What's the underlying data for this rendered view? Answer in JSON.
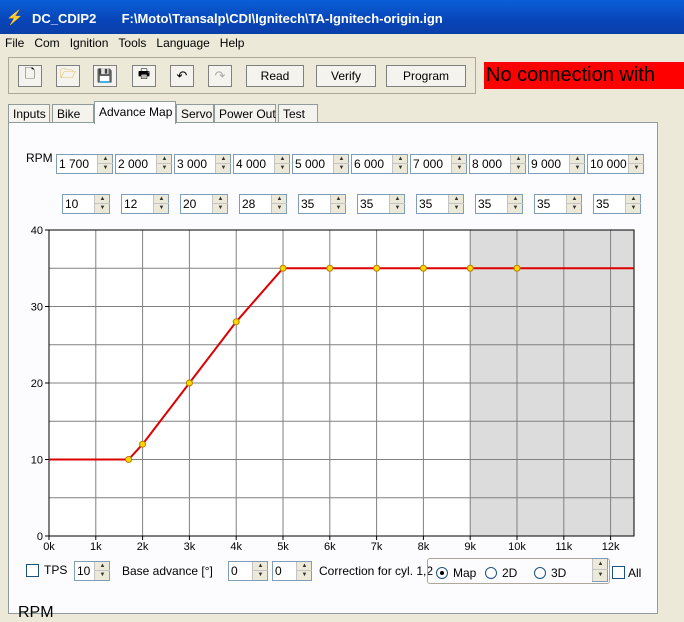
{
  "window": {
    "title": "DC_CDIP2       F:\\Moto\\Transalp\\CDI\\Ignitech\\TA-Ignitech-origin.ign"
  },
  "menu": [
    "File",
    "Com",
    "Ignition",
    "Tools",
    "Language",
    "Help"
  ],
  "toolbar": {
    "read_label": "Read",
    "verify_label": "Verify",
    "program_label": "Program"
  },
  "status": {
    "text": "No connection with"
  },
  "tabs": [
    "Inputs",
    "Bike",
    "Advance Map",
    "Servo",
    "Power Out",
    "Test"
  ],
  "active_tab": "Advance Map",
  "map": {
    "rpm_label": "RPM",
    "rpm_values": [
      "1 700",
      "2 000",
      "3 000",
      "4 000",
      "5 000",
      "6 000",
      "7 000",
      "8 000",
      "9 000",
      "10 000"
    ],
    "advance_values": [
      "10",
      "12",
      "20",
      "28",
      "35",
      "35",
      "35",
      "35",
      "35",
      "35"
    ]
  },
  "chart_data": {
    "type": "line",
    "x": [
      0,
      1700,
      2000,
      3000,
      4000,
      5000,
      6000,
      7000,
      8000,
      9000,
      10000,
      12500
    ],
    "y": [
      10,
      10,
      12,
      20,
      28,
      35,
      35,
      35,
      35,
      35,
      35,
      35
    ],
    "points_x": [
      1700,
      2000,
      3000,
      4000,
      5000,
      6000,
      7000,
      8000,
      9000,
      10000
    ],
    "points_y": [
      10,
      12,
      20,
      28,
      35,
      35,
      35,
      35,
      35,
      35
    ],
    "xlim": [
      0,
      12500
    ],
    "ylim": [
      0,
      40
    ],
    "x_ticks": [
      "0k",
      "1k",
      "2k",
      "3k",
      "4k",
      "5k",
      "6k",
      "7k",
      "8k",
      "9k",
      "10k",
      "11k",
      "12k"
    ],
    "y_ticks": [
      "0",
      "10",
      "20",
      "30",
      "40"
    ],
    "shaded_from_x": 9000,
    "grid": true,
    "colors": {
      "line": "#dd0000",
      "point": "#ffd700",
      "shade": "#dcdcdc"
    }
  },
  "bottom": {
    "tps_label": "TPS",
    "base_value": "10",
    "base_label": "Base advance [°]",
    "corr1": "0",
    "corr2": "0",
    "correction_label": "Correction for cyl. 1,2",
    "view_map": "Map",
    "view_2d": "2D",
    "view_3d": "3D",
    "all_label": "All"
  },
  "footer_text": "RPM"
}
